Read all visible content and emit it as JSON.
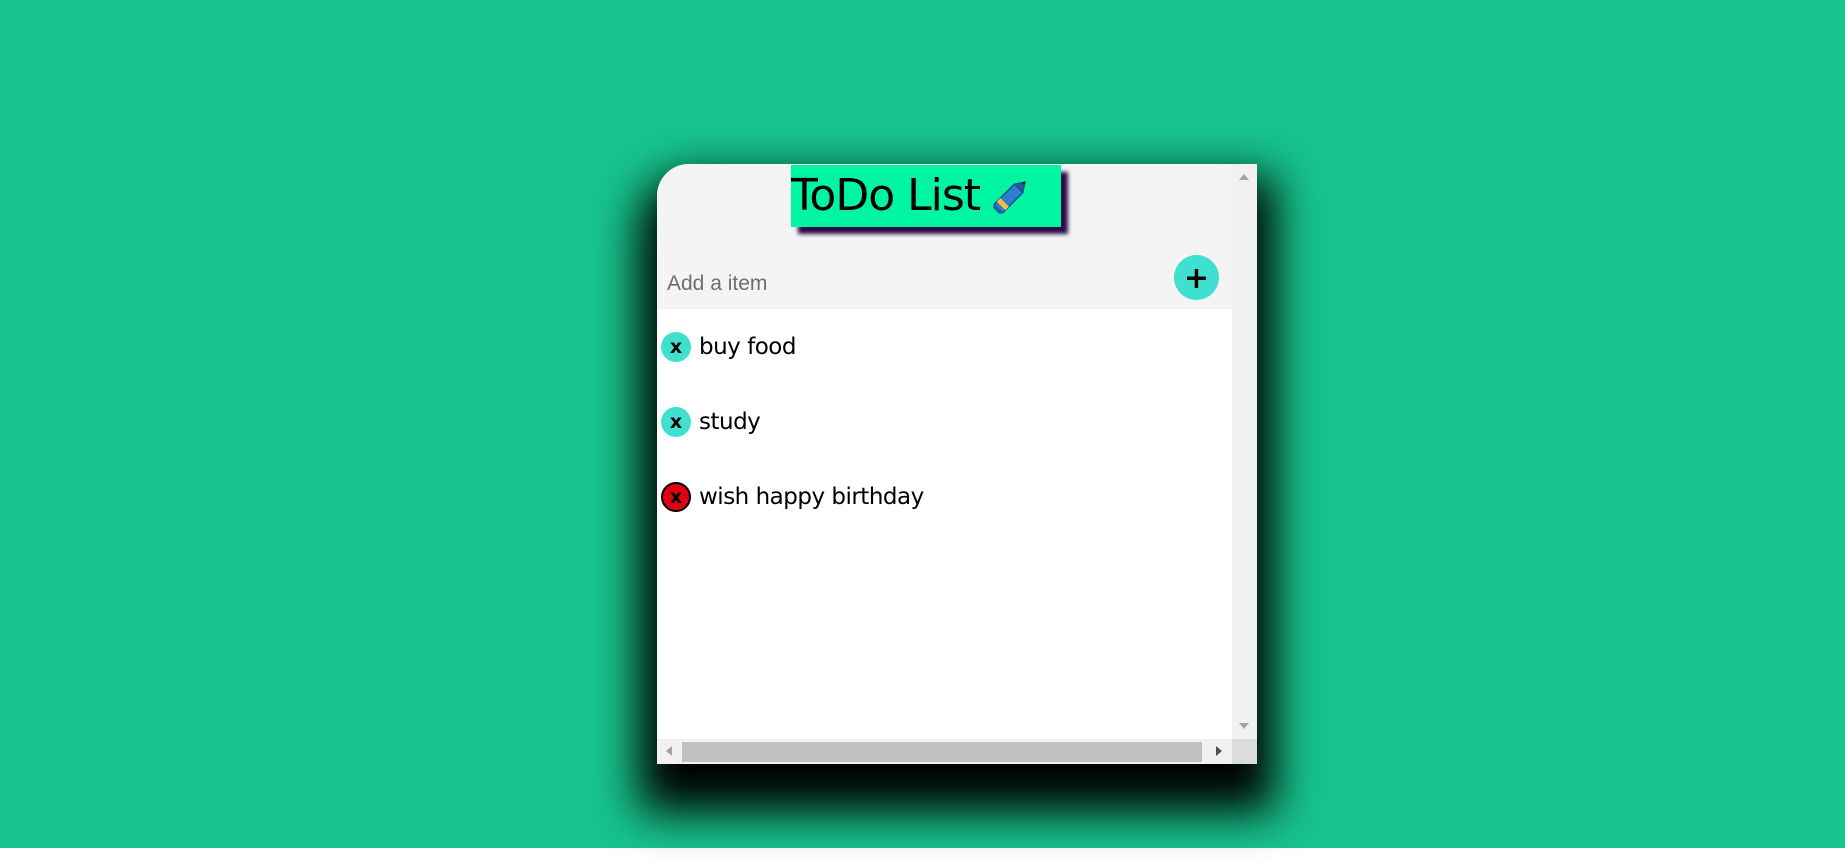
{
  "app": {
    "title": "ToDo List",
    "title_icon": "pen-icon"
  },
  "colors": {
    "page_background": "#17c48d",
    "title_background": "#00f5a3",
    "button_accent": "#40e0d0",
    "delete_hover": "#e00010"
  },
  "input": {
    "placeholder": "Add a item",
    "value": ""
  },
  "add_button": {
    "label": "+"
  },
  "items": [
    {
      "remove_label": "x",
      "text": "buy food",
      "state": "normal"
    },
    {
      "remove_label": "x",
      "text": "study",
      "state": "normal"
    },
    {
      "remove_label": "x",
      "text": "wish happy birthday",
      "state": "hover"
    }
  ]
}
